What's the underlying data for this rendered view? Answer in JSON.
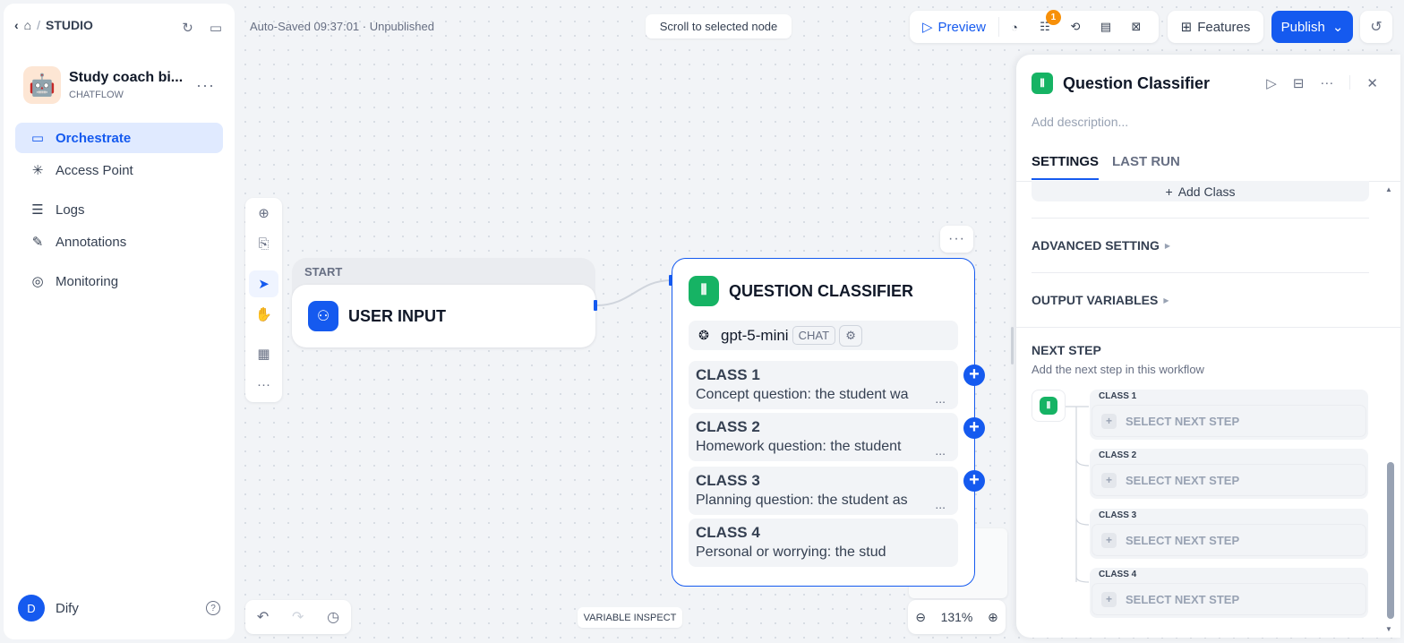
{
  "sidebar": {
    "breadcrumb": {
      "section": "STUDIO"
    },
    "app": {
      "name": "Study coach bi...",
      "type": "CHATFLOW",
      "avatar": "🤖"
    },
    "nav": [
      {
        "label": "Orchestrate",
        "icon": "orchestrate-icon",
        "glyph": "▭",
        "active": true
      },
      {
        "label": "Access Point",
        "icon": "access-point-icon",
        "glyph": "✳",
        "active": false
      },
      {
        "label": "Logs",
        "icon": "logs-icon",
        "glyph": "☰",
        "active": false
      },
      {
        "label": "Annotations",
        "icon": "annotations-icon",
        "glyph": "✎",
        "active": false
      },
      {
        "label": "Monitoring",
        "icon": "monitoring-icon",
        "glyph": "◎",
        "active": false
      }
    ],
    "user": {
      "initial": "D",
      "name": "Dify"
    }
  },
  "topbar": {
    "autosave": "Auto-Saved 09:37:01 · Unpublished",
    "scroll_to_selected": "Scroll to selected node",
    "preview_label": "Preview",
    "checklist_badge": "1",
    "features_label": "Features",
    "publish_label": "Publish"
  },
  "canvas": {
    "variable_inspect": "VARIABLE INSPECT",
    "zoom": "131%",
    "start_node": {
      "label": "START",
      "title": "USER INPUT"
    },
    "qc_node": {
      "title": "QUESTION CLASSIFIER",
      "model": "gpt-5-mini",
      "model_mode": "CHAT",
      "classes": [
        {
          "name": "CLASS 1",
          "desc": "Concept question: the student wa"
        },
        {
          "name": "CLASS 2",
          "desc": "Homework question: the student "
        },
        {
          "name": "CLASS 3",
          "desc": "Planning question: the student as"
        },
        {
          "name": "CLASS 4",
          "desc": "Personal or worrying: the stud"
        }
      ]
    }
  },
  "panel": {
    "title": "Question Classifier",
    "description_placeholder": "Add description...",
    "tabs": [
      "SETTINGS",
      "LAST RUN"
    ],
    "add_class": "Add Class",
    "advanced_setting": "ADVANCED SETTING",
    "output_variables": "OUTPUT VARIABLES",
    "next_step_title": "NEXT STEP",
    "next_step_sub": "Add the next step in this workflow",
    "next_steps": [
      {
        "label": "CLASS 1",
        "action": "SELECT NEXT STEP"
      },
      {
        "label": "CLASS 2",
        "action": "SELECT NEXT STEP"
      },
      {
        "label": "CLASS 3",
        "action": "SELECT NEXT STEP"
      },
      {
        "label": "CLASS 4",
        "action": "SELECT NEXT STEP"
      }
    ]
  },
  "colors": {
    "accent": "#155aef",
    "classifier_green": "#16b364",
    "badge_orange": "#f79009"
  }
}
